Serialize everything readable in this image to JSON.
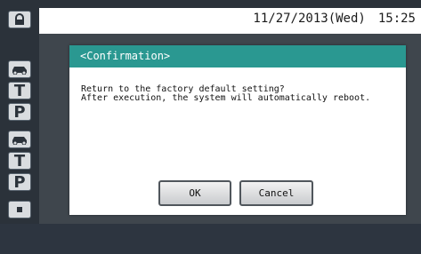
{
  "status_bar": {
    "date": "11/27/2013(Wed)",
    "time": "15:25"
  },
  "sidebar": {
    "items": [
      {
        "icon": "lock-icon"
      },
      {
        "icon": "car-icon"
      },
      {
        "label": "T"
      },
      {
        "label": "P"
      },
      {
        "icon": "car-icon"
      },
      {
        "label": "T"
      },
      {
        "label": "P"
      },
      {
        "icon": "dot-icon"
      }
    ]
  },
  "dialog": {
    "title": "<Confirmation>",
    "message_line1": "Return to the factory default setting?",
    "message_line2": "After execution, the system will automatically reboot.",
    "ok_label": "OK",
    "cancel_label": "Cancel"
  },
  "colors": {
    "header_teal": "#2a9891",
    "background_dark": "#2b323a",
    "overlay": "#3f464d"
  }
}
